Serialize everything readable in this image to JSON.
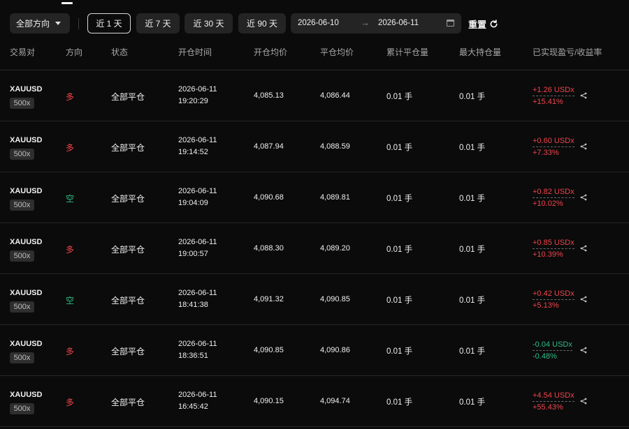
{
  "filters": {
    "direction_label": "全部方向",
    "ranges": [
      "近 1 天",
      "近 7 天",
      "近 30 天",
      "近 90 天"
    ],
    "active_range": "近 1 天",
    "date_start": "2026-06-10",
    "date_end": "2026-06-11",
    "reset_label": "重置"
  },
  "columns": [
    "交易对",
    "方向",
    "状态",
    "开仓时间",
    "开仓均价",
    "平仓均价",
    "累计平仓量",
    "最大持仓量",
    "已实现盈亏/收益率"
  ],
  "rows": [
    {
      "pair": "XAUUSD",
      "leverage": "500x",
      "direction": "多",
      "status": "全部平仓",
      "open_date": "2026-06-11",
      "open_time": "19:20:29",
      "open_price": "4,085.13",
      "close_price": "4,086.44",
      "closed_qty": "0.01 手",
      "max_qty": "0.01 手",
      "pnl": "+1.26 USDx",
      "roi": "+15.41%"
    },
    {
      "pair": "XAUUSD",
      "leverage": "500x",
      "direction": "多",
      "status": "全部平仓",
      "open_date": "2026-06-11",
      "open_time": "19:14:52",
      "open_price": "4,087.94",
      "close_price": "4,088.59",
      "closed_qty": "0.01 手",
      "max_qty": "0.01 手",
      "pnl": "+0.60 USDx",
      "roi": "+7.33%"
    },
    {
      "pair": "XAUUSD",
      "leverage": "500x",
      "direction": "空",
      "status": "全部平仓",
      "open_date": "2026-06-11",
      "open_time": "19:04:09",
      "open_price": "4,090.68",
      "close_price": "4,089.81",
      "closed_qty": "0.01 手",
      "max_qty": "0.01 手",
      "pnl": "+0.82 USDx",
      "roi": "+10.02%"
    },
    {
      "pair": "XAUUSD",
      "leverage": "500x",
      "direction": "多",
      "status": "全部平仓",
      "open_date": "2026-06-11",
      "open_time": "19:00:57",
      "open_price": "4,088.30",
      "close_price": "4,089.20",
      "closed_qty": "0.01 手",
      "max_qty": "0.01 手",
      "pnl": "+0.85 USDx",
      "roi": "+10.39%"
    },
    {
      "pair": "XAUUSD",
      "leverage": "500x",
      "direction": "空",
      "status": "全部平仓",
      "open_date": "2026-06-11",
      "open_time": "18:41:38",
      "open_price": "4,091.32",
      "close_price": "4,090.85",
      "closed_qty": "0.01 手",
      "max_qty": "0.01 手",
      "pnl": "+0.42 USDx",
      "roi": "+5.13%"
    },
    {
      "pair": "XAUUSD",
      "leverage": "500x",
      "direction": "多",
      "status": "全部平仓",
      "open_date": "2026-06-11",
      "open_time": "18:36:51",
      "open_price": "4,090.85",
      "close_price": "4,090.86",
      "closed_qty": "0.01 手",
      "max_qty": "0.01 手",
      "pnl": "-0.04 USDx",
      "roi": "-0.48%"
    },
    {
      "pair": "XAUUSD",
      "leverage": "500x",
      "direction": "多",
      "status": "全部平仓",
      "open_date": "2026-06-11",
      "open_time": "16:45:42",
      "open_price": "4,090.15",
      "close_price": "4,094.74",
      "closed_qty": "0.01 手",
      "max_qty": "0.01 手",
      "pnl": "+4.54 USDx",
      "roi": "+55.43%"
    }
  ],
  "colors": {
    "long": "#f0444c",
    "short": "#2ebd85",
    "profit": "#f0444c",
    "loss": "#2ebd85"
  }
}
